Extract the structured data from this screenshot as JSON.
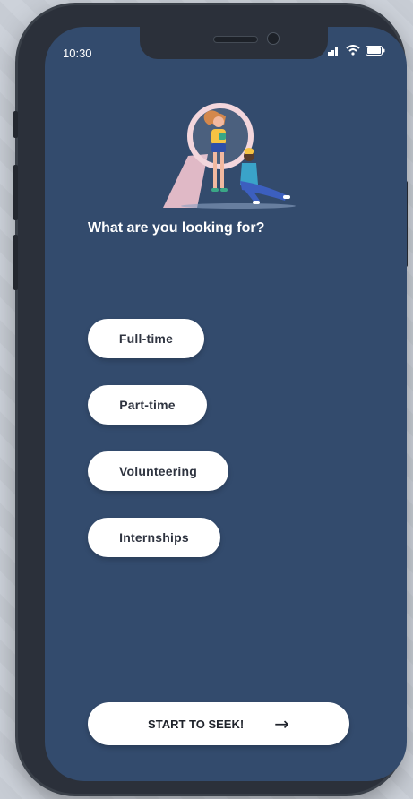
{
  "status_bar": {
    "time": "10:30",
    "icons": [
      "signal-icon",
      "wifi-icon",
      "battery-icon"
    ]
  },
  "illustration": {
    "icon": "magnifying-glass-people-illustration"
  },
  "question": "What are you looking for?",
  "options": [
    {
      "label": "Full-time"
    },
    {
      "label": "Part-time"
    },
    {
      "label": "Volunteering"
    },
    {
      "label": "Internships"
    }
  ],
  "start_button": {
    "label": "START TO SEEK!",
    "icon": "arrow-right-icon"
  },
  "colors": {
    "screen_bg": "#334b6d",
    "button_bg": "#ffffff",
    "text_dark": "#2f3440",
    "accent_yellow": "#f6c343",
    "accent_pink": "#f3c5cf",
    "accent_blue": "#3c5fbf"
  }
}
